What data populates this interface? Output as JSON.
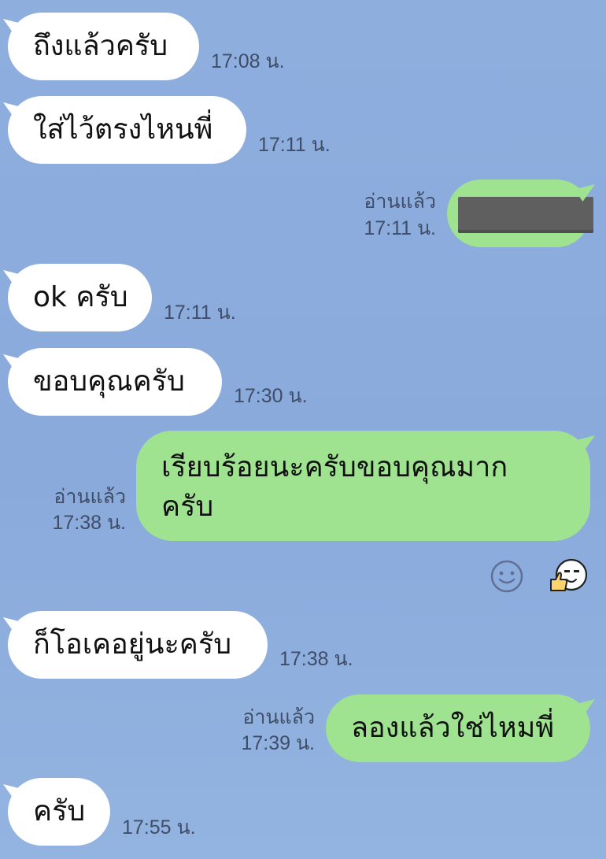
{
  "messages": [
    {
      "side": "in",
      "text": "ถึงแล้วครับ",
      "time": "17:08 น."
    },
    {
      "side": "in",
      "text": "ใส่ไว้ตรงไหนพี่",
      "time": "17:11 น."
    },
    {
      "side": "out",
      "text": "",
      "read": "อ่านแล้ว",
      "time": "17:11 น.",
      "redacted": true
    },
    {
      "side": "in",
      "text": "ok ครับ",
      "time": "17:11 น."
    },
    {
      "side": "in",
      "text": "ขอบคุณครับ",
      "time": "17:30 น."
    },
    {
      "side": "out",
      "text": "เรียบร้อยนะครับขอบคุณมาก ครับ",
      "read": "อ่านแล้ว",
      "time": "17:38 น."
    },
    {
      "side": "in",
      "text": "ก็โอเคอยู่นะครับ",
      "time": "17:38 น."
    },
    {
      "side": "out",
      "text": "ลองแล้วใช่ไหมพี่",
      "read": "อ่านแล้ว",
      "time": "17:39 น."
    },
    {
      "side": "in",
      "text": "ครับ",
      "time": "17:55 น."
    }
  ],
  "reactions": {
    "add": "smiley-add-icon",
    "applied": "thumbs-up-face-icon"
  },
  "colors": {
    "background": "#8eaede",
    "incoming": "#ffffff",
    "outgoing": "#9fe391"
  }
}
